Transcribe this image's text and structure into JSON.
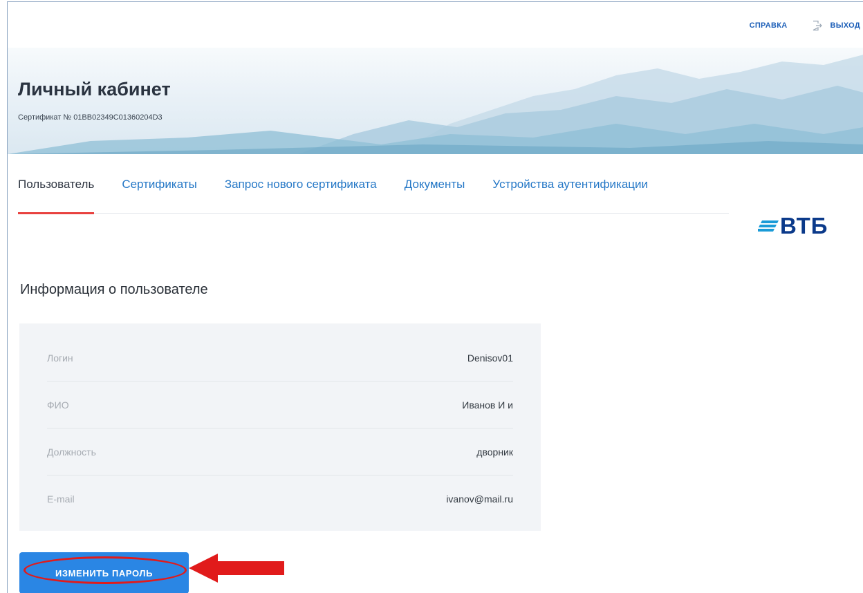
{
  "top_links": {
    "help": "СПРАВКА",
    "logout": "ВЫХОД"
  },
  "banner": {
    "title": "Личный кабинет",
    "certificate": "Сертификат № 01BB02349C01360204D3"
  },
  "tabs": [
    {
      "label": "Пользователь",
      "active": true
    },
    {
      "label": "Сертификаты",
      "active": false
    },
    {
      "label": "Запрос нового сертификата",
      "active": false
    },
    {
      "label": "Документы",
      "active": false
    },
    {
      "label": "Устройства аутентификации",
      "active": false
    }
  ],
  "logo": {
    "text": "ВТБ"
  },
  "section_title": "Информация о пользователе",
  "user_info": [
    {
      "label": "Логин",
      "value": "Denisov01"
    },
    {
      "label": "ФИО",
      "value": "Иванов И и"
    },
    {
      "label": "Должность",
      "value": "дворник"
    },
    {
      "label": "E-mail",
      "value": "ivanov@mail.ru"
    }
  ],
  "change_password_button": "ИЗМЕНИТЬ ПАРОЛЬ",
  "colors": {
    "accent": "#2a86e4",
    "tab_active_underline": "#e8413f",
    "annotation": "#e11b1b",
    "brand": "#0b3a8a"
  },
  "icons": {
    "logout": "exit-icon",
    "logo_mark": "vtb-lines-icon",
    "annotation_arrow": "arrow-left-icon"
  }
}
